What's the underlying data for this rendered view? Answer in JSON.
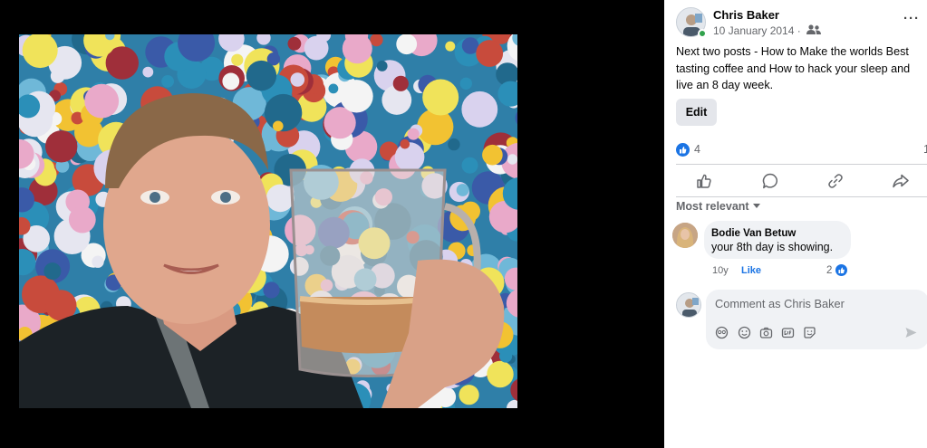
{
  "post": {
    "author": "Chris Baker",
    "date": "10 January 2014 ·",
    "text": "Next two posts - How to Make the worlds Best tasting coffee and How to hack your sleep and live an 8 day week.",
    "edit_label": "Edit",
    "reaction_count": "4",
    "comment_count": "1"
  },
  "comments": {
    "sort_label": "Most relevant",
    "items": [
      {
        "name": "Bodie Van Betuw",
        "text": "your 8th day is showing.",
        "age": "10y",
        "like_label": "Like",
        "reaction_count": "2"
      }
    ]
  },
  "composer": {
    "placeholder": "Comment as Chris Baker"
  },
  "icons": {
    "audience": "friends-icon",
    "more": "more-options-icon",
    "actions": [
      "like-icon",
      "comment-icon",
      "share-link-icon",
      "share-forward-icon"
    ],
    "composer_tools": [
      "avatar-sticker-icon",
      "emoji-icon",
      "camera-icon",
      "gif-icon",
      "sticker-icon"
    ],
    "send": "send-icon"
  },
  "colors": {
    "accent": "#1b74e4",
    "online": "#31a24c"
  }
}
